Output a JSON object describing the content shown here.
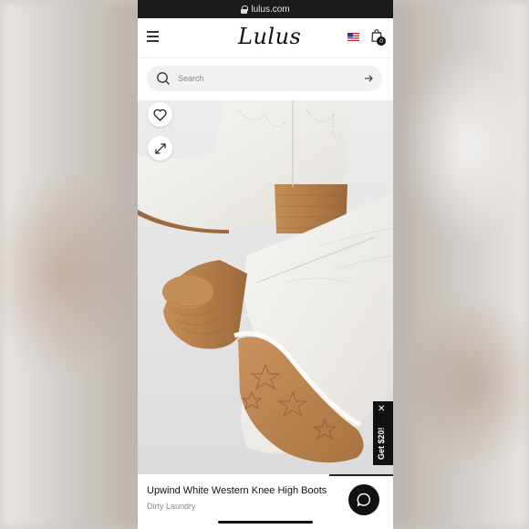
{
  "status_bar": {
    "url": "lulus.com"
  },
  "header": {
    "logo_text": "Lulus",
    "cart_count": "0"
  },
  "search": {
    "placeholder": "Search"
  },
  "product": {
    "name": "Upwind White Western Knee High Boots",
    "brand": "Dirty Laundry"
  },
  "promo": {
    "label": "Get $20!"
  },
  "colors": {
    "status_bar_bg": "#1b1b1b",
    "boot_white": "#f2f0ec",
    "heel_tan": "#b07a45",
    "accent_black": "#111111"
  },
  "icons": [
    "lock-icon",
    "menu-icon",
    "us-flag-icon",
    "bag-icon",
    "search-icon",
    "arrow-right-icon",
    "heart-icon",
    "expand-icon",
    "close-icon",
    "chat-icon"
  ]
}
